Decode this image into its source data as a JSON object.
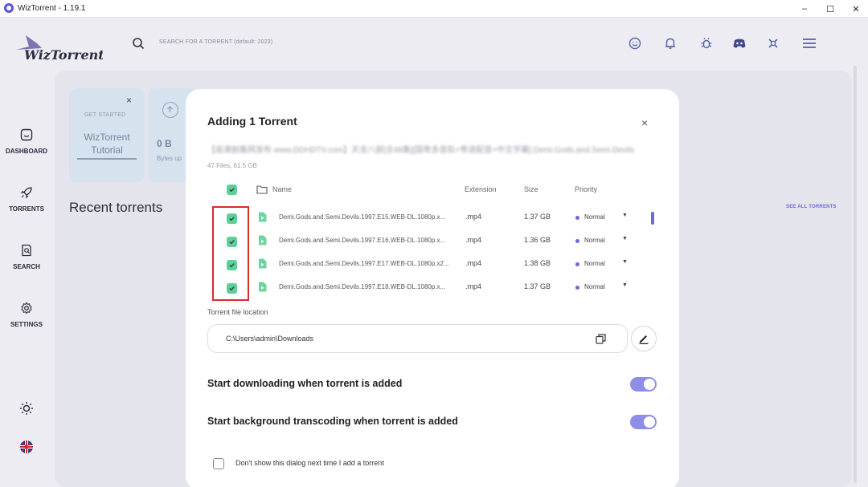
{
  "window": {
    "title": "WizTorrent - 1.19.1",
    "minimize": "–",
    "maximize": "☐",
    "close": "✕"
  },
  "header": {
    "logo_text": "WizTorrent",
    "search_placeholder": "SEARCH FOR A TORRENT (default: 2023)"
  },
  "sidebar": {
    "items": [
      {
        "label": "DASHBOARD",
        "icon": "home-icon"
      },
      {
        "label": "TORRENTS",
        "icon": "rocket-icon"
      },
      {
        "label": "SEARCH",
        "icon": "search-doc-icon"
      },
      {
        "label": "SETTINGS",
        "icon": "gear-icon"
      }
    ]
  },
  "dashboard": {
    "card1": {
      "label": "GET STARTED",
      "title_line1": "WizTorrent",
      "title_line2": "Tutorial",
      "close": "×"
    },
    "card2": {
      "value": "0 B",
      "label": "Bytes up"
    },
    "recent_title": "Recent torrents",
    "see_all": "SEE ALL TORRENTS"
  },
  "modal": {
    "title": "Adding 1 Torrent",
    "close": "×",
    "torrent_name": "【高清剧集网发布 www.DDHDTV.com】天龙八部[全48集][国粤多音轨+粤语配音+中文字幕].Demi.Gods.and.Semi.Devils",
    "meta": "47 Files, 61.5 GB",
    "columns": {
      "name": "Name",
      "extension": "Extension",
      "size": "Size",
      "priority": "Priority"
    },
    "files": [
      {
        "name": "Demi.Gods.and.Semi.Devils.1997.E15.WEB-DL.1080p.x...",
        "ext": ".mp4",
        "size": "1.37 GB",
        "priority": "Normal"
      },
      {
        "name": "Demi.Gods.and.Semi.Devils.1997.E16.WEB-DL.1080p.x...",
        "ext": ".mp4",
        "size": "1.36 GB",
        "priority": "Normal"
      },
      {
        "name": "Demi.Gods.and.Semi.Devils.1997.E17.WEB-DL.1080p.x2...",
        "ext": ".mp4",
        "size": "1.38 GB",
        "priority": "Normal"
      },
      {
        "name": "Demi.Gods.and.Semi.Devils.1997.E18.WEB-DL.1080p.x...",
        "ext": ".mp4",
        "size": "1.37 GB",
        "priority": "Normal"
      }
    ],
    "location_label": "Torrent file location",
    "location_value": "C:\\Users\\admin\\Downloads",
    "option1": "Start downloading when torrent is added",
    "option2": "Start background transcoding when torrent is added",
    "dont_show": "Don't show this dialog next time I add a torrent"
  },
  "colors": {
    "accent": "#6a6ad8",
    "check": "#5fcf9a",
    "highlight": "#d92b2b"
  }
}
